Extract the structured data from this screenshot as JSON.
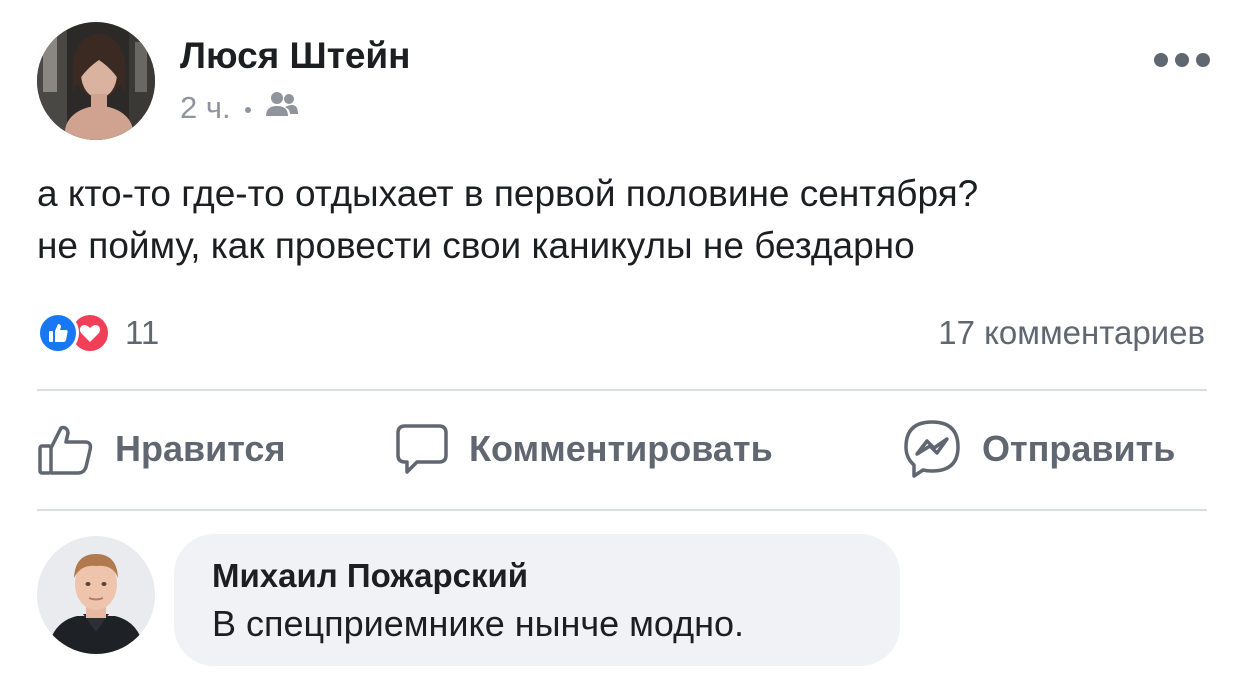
{
  "post": {
    "author": "Люся Штейн",
    "time": "2 ч.",
    "audience_icon": "friends-icon",
    "text_lines": [
      "а кто-то где-то отдыхает в первой половине сентября?",
      "не пойму, как провести свои каникулы не бездарно"
    ],
    "reaction_icons": [
      "like-icon",
      "love-icon"
    ],
    "reaction_count": "11",
    "comments_count": "17 комментариев"
  },
  "actions": {
    "like_label": "Нравится",
    "comment_label": "Комментировать",
    "share_label": "Отправить"
  },
  "comment": {
    "author": "Михаил Пожарский",
    "text": "В спецприемнике нынче модно."
  },
  "colors": {
    "text": "#1c1e21",
    "secondary_text": "#606770",
    "meta_text": "#90949c",
    "like_blue": "#1877f2",
    "love_red": "#f33e58",
    "divider": "#dadde1",
    "comment_bubble": "#f0f2f5"
  }
}
